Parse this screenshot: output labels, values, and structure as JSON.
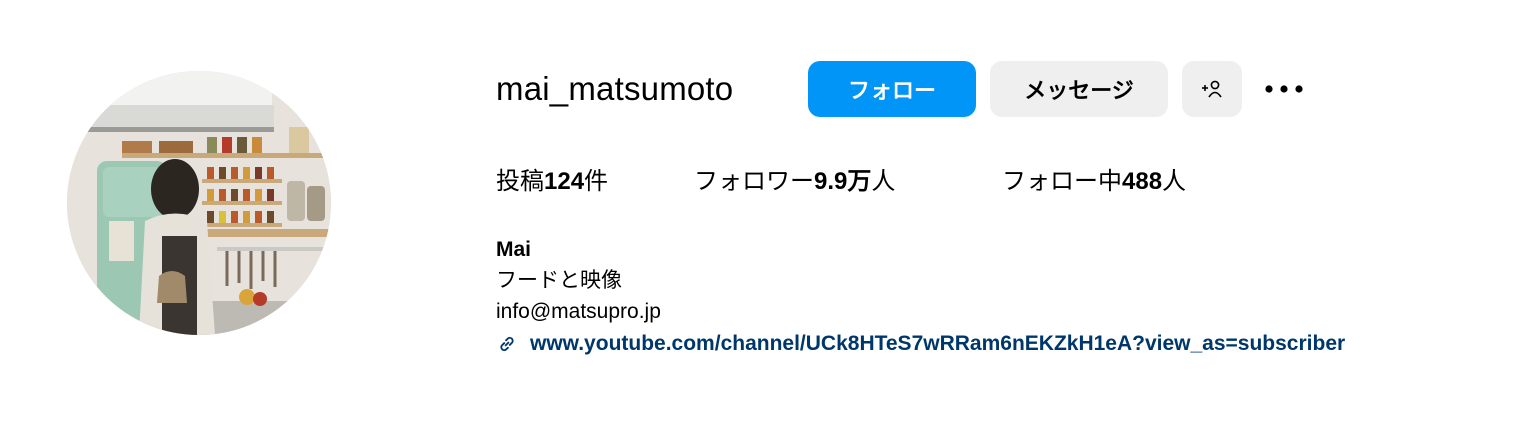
{
  "profile": {
    "username": "mai_matsumoto",
    "follow_label": "フォロー",
    "message_label": "メッセージ",
    "add_user_icon": "person-add-icon",
    "more_icon": "more-horizontal-icon",
    "avatar_alt": "profile-photo"
  },
  "stats": {
    "posts_label": "投稿",
    "posts_value": "124",
    "posts_unit": "件",
    "followers_label": "フォロワー",
    "followers_value": "9.9万",
    "followers_unit": "人",
    "following_label": "フォロー中",
    "following_value": "488",
    "following_unit": "人"
  },
  "bio": {
    "name": "Mai",
    "line1": "フードと映像",
    "line2": "info@matsupro.jp",
    "link_icon": "link-icon",
    "link": "www.youtube.com/channel/UCk8HTeS7wRRam6nEKZkH1eA?view_as=subscriber"
  },
  "colors": {
    "follow_button": "#0095f6",
    "secondary_button": "#efefef",
    "link_text": "#00376b"
  }
}
